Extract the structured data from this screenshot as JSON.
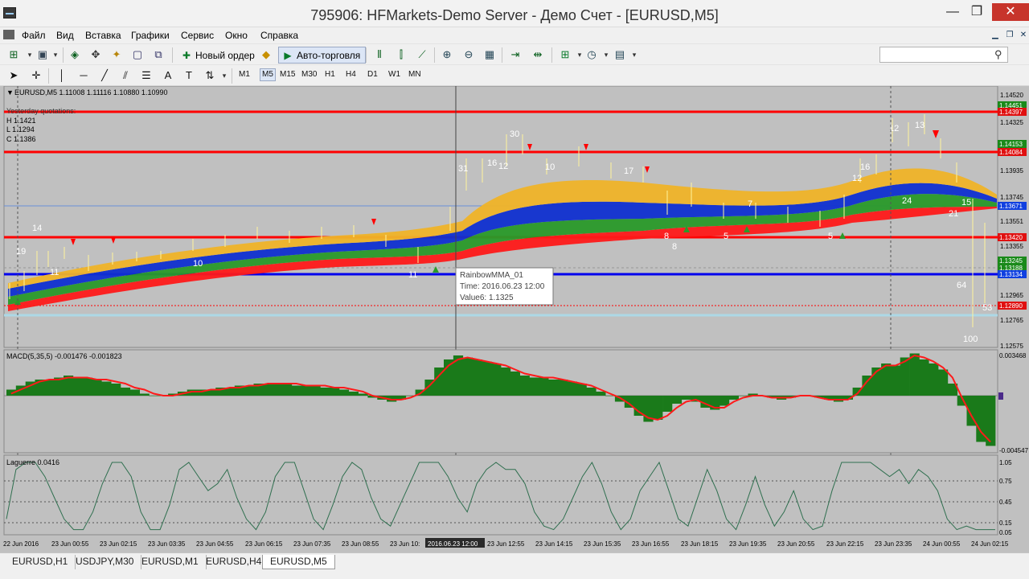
{
  "window": {
    "title": "795906: HFMarkets-Demo Server - Демо Счет - [EURUSD,M5]",
    "minimize": "—",
    "maximize": "❐",
    "close": "✕"
  },
  "menu": [
    "Файл",
    "Вид",
    "Вставка",
    "Графики",
    "Сервис",
    "Окно",
    "Справка"
  ],
  "toolbar": {
    "new_order": "Новый ордер",
    "autotrading": "Авто-торговля",
    "search_placeholder": ""
  },
  "periods": [
    "M1",
    "M5",
    "M15",
    "M30",
    "H1",
    "H4",
    "D1",
    "W1",
    "MN"
  ],
  "active_period": "M5",
  "chart": {
    "header": "EURUSD,M5  1.11008 1.11116 1.10880 1.10990",
    "quotes_label": "Yesterday quotations:",
    "high": "H 1.1421",
    "low": "L 1.1294",
    "close": "C 1.1386",
    "price_scale": [
      "1.14520",
      "1.14325",
      "1.13935",
      "1.13745",
      "1.13551",
      "1.13355",
      "1.12965",
      "1.12765",
      "1.12575"
    ],
    "price_tags": [
      {
        "text": "1.14451",
        "color": "#1a8a1a"
      },
      {
        "text": "1.14397",
        "color": "#e01010"
      },
      {
        "text": "1.14153",
        "color": "#1a8a1a"
      },
      {
        "text": "1.14084",
        "color": "#e01010"
      },
      {
        "text": "1.13671",
        "color": "#1040e0"
      },
      {
        "text": "1.13420",
        "color": "#e01010"
      },
      {
        "text": "1.13245",
        "color": "#1a8a1a"
      },
      {
        "text": "1.13188",
        "color": "#1a8a1a"
      },
      {
        "text": "1.13134",
        "color": "#1040e0"
      },
      {
        "text": "1.12890",
        "color": "#e01010"
      }
    ],
    "labels": [
      "30",
      "16",
      "12",
      "10",
      "31",
      "14",
      "19",
      "11",
      "10",
      "12",
      "24",
      "15",
      "13",
      "12",
      "21",
      "64",
      "100",
      "53",
      "5",
      "8",
      "16",
      "17",
      "8",
      "5",
      "7",
      "11"
    ],
    "tooltip": {
      "name": "RainbowMMA_01",
      "time": "Time: 2016.06.23 12:00",
      "value": "Value6: 1.1325"
    }
  },
  "macd": {
    "label": "MACD(5,35,5) -0.001476 -0.001823",
    "scale_top": "0.003468",
    "scale_bottom": "-0.004547",
    "hist": [
      0.3,
      0.5,
      0.7,
      0.8,
      0.8,
      0.9,
      1.0,
      0.9,
      0.9,
      0.8,
      0.7,
      0.6,
      0.4,
      0.3,
      0.1,
      0.0,
      0.0,
      0.1,
      0.2,
      0.3,
      0.3,
      0.3,
      0.4,
      0.4,
      0.5,
      0.5,
      0.6,
      0.6,
      0.6,
      0.6,
      0.5,
      0.5,
      0.5,
      0.4,
      0.4,
      0.3,
      0.2,
      0.1,
      -0.1,
      -0.2,
      -0.3,
      -0.2,
      0.0,
      0.3,
      0.8,
      1.4,
      1.8,
      2.0,
      1.9,
      1.8,
      1.7,
      1.6,
      1.4,
      1.2,
      1.0,
      0.9,
      0.9,
      0.8,
      0.8,
      0.7,
      0.6,
      0.4,
      0.2,
      0.0,
      -0.3,
      -0.6,
      -1.0,
      -1.3,
      -1.2,
      -0.8,
      -0.4,
      -0.2,
      -0.3,
      -0.6,
      -0.7,
      -0.5,
      -0.2,
      0.0,
      0.1,
      0.0,
      -0.1,
      -0.2,
      -0.1,
      0.0,
      0.0,
      -0.1,
      -0.2,
      -0.3,
      -0.2,
      0.4,
      1.0,
      1.4,
      1.6,
      1.5,
      1.9,
      2.1,
      1.8,
      1.6,
      1.3,
      0.6,
      -0.5,
      -1.5,
      -2.3,
      -2.5
    ],
    "signal": [
      0.1,
      0.3,
      0.5,
      0.7,
      0.8,
      0.8,
      0.9,
      0.9,
      0.9,
      0.8,
      0.8,
      0.7,
      0.6,
      0.4,
      0.3,
      0.1,
      0.0,
      0.0,
      0.1,
      0.2,
      0.2,
      0.3,
      0.3,
      0.4,
      0.4,
      0.5,
      0.5,
      0.6,
      0.6,
      0.6,
      0.6,
      0.5,
      0.5,
      0.5,
      0.4,
      0.4,
      0.3,
      0.2,
      0.0,
      -0.1,
      -0.2,
      -0.2,
      -0.1,
      0.1,
      0.5,
      1.0,
      1.5,
      1.8,
      1.9,
      1.8,
      1.7,
      1.6,
      1.5,
      1.3,
      1.1,
      1.0,
      0.9,
      0.9,
      0.8,
      0.7,
      0.6,
      0.5,
      0.3,
      0.1,
      -0.1,
      -0.4,
      -0.8,
      -1.1,
      -1.2,
      -1.0,
      -0.6,
      -0.3,
      -0.2,
      -0.4,
      -0.6,
      -0.6,
      -0.3,
      -0.1,
      0.0,
      0.0,
      -0.1,
      -0.1,
      -0.1,
      0.0,
      0.0,
      -0.1,
      -0.2,
      -0.2,
      -0.2,
      0.1,
      0.7,
      1.2,
      1.5,
      1.5,
      1.7,
      2.0,
      1.9,
      1.7,
      1.4,
      0.9,
      -0.1,
      -1.0,
      -1.8,
      -2.3
    ]
  },
  "laguerre": {
    "label": "Laguerre 0.0416",
    "levels": [
      "1.05",
      "0.75",
      "0.45",
      "0.15",
      "0.05"
    ],
    "values": [
      0.2,
      0.9,
      1.0,
      1.0,
      0.8,
      0.5,
      0.2,
      0.05,
      0.05,
      0.3,
      0.7,
      1.0,
      1.0,
      0.8,
      0.3,
      0.05,
      0.05,
      0.4,
      0.9,
      1.0,
      0.8,
      0.6,
      0.7,
      0.9,
      0.5,
      0.2,
      0.05,
      0.3,
      0.8,
      1.0,
      1.0,
      0.6,
      0.2,
      0.05,
      0.4,
      0.8,
      1.0,
      0.9,
      0.5,
      0.2,
      0.1,
      0.4,
      0.7,
      1.0,
      1.0,
      1.0,
      0.8,
      0.5,
      0.3,
      0.7,
      0.9,
      1.0,
      0.9,
      0.9,
      0.7,
      0.3,
      0.1,
      0.05,
      0.2,
      0.5,
      0.8,
      1.0,
      0.7,
      0.3,
      0.05,
      0.2,
      0.6,
      0.8,
      1.0,
      0.6,
      0.2,
      0.1,
      0.5,
      0.9,
      0.6,
      0.2,
      0.05,
      0.4,
      0.8,
      0.4,
      0.1,
      0.3,
      0.6,
      0.2,
      0.05,
      0.1,
      0.6,
      1.0,
      1.0,
      1.0,
      1.0,
      0.9,
      0.8,
      0.9,
      0.7,
      0.9,
      0.8,
      0.6,
      0.2,
      0.05,
      0.1,
      0.05,
      0.05,
      0.05
    ]
  },
  "time_axis": [
    "22 Jun 2016",
    "23 Jun 00:55",
    "23 Jun 02:15",
    "23 Jun 03:35",
    "23 Jun 04:55",
    "23 Jun 06:15",
    "23 Jun 07:35",
    "23 Jun 08:55",
    "23 Jun 10:",
    "2016.06.23 12:00",
    "23 Jun 12:55",
    "23 Jun 14:15",
    "23 Jun 15:35",
    "23 Jun 16:55",
    "23 Jun 18:15",
    "23 Jun 19:35",
    "23 Jun 20:55",
    "23 Jun 22:15",
    "23 Jun 23:35",
    "24 Jun 00:55",
    "24 Jun 02:15"
  ],
  "tabs": [
    "EURUSD,H1",
    "USDJPY,M30",
    "EURUSD,M1",
    "EURUSD,H4",
    "EURUSD,M5"
  ],
  "active_tab": "EURUSD,M5"
}
